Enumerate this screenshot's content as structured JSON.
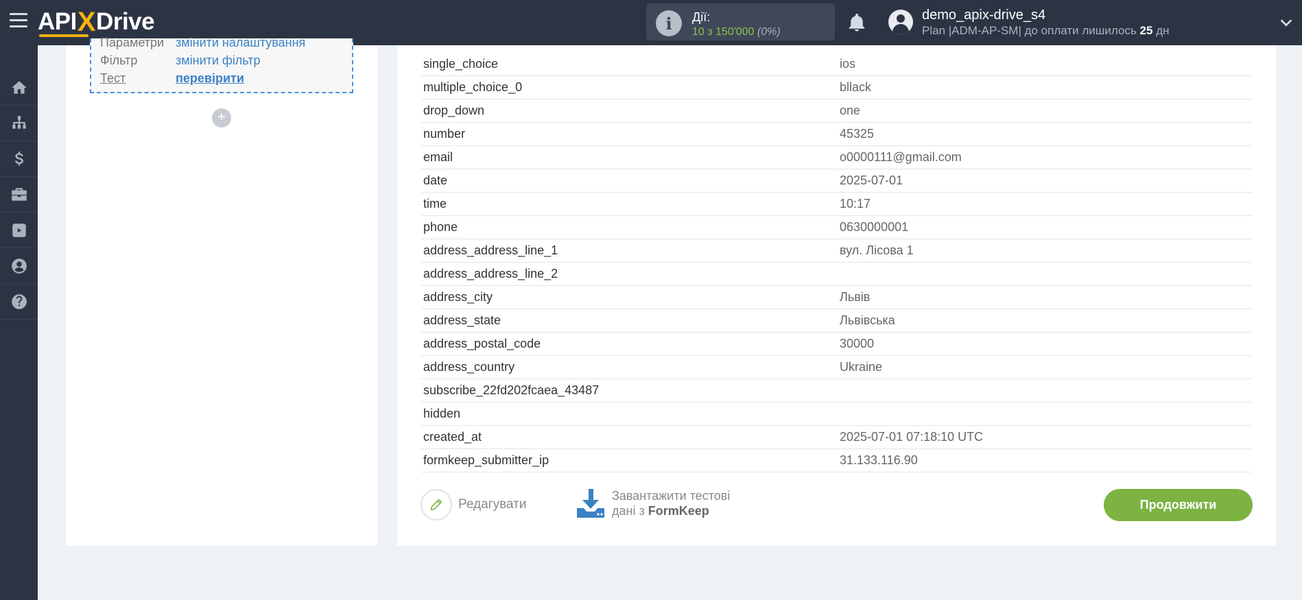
{
  "app": {
    "logo_pre": "API",
    "logo_x": "X",
    "logo_post": "Drive"
  },
  "topbar": {
    "actions_label": "Дії:",
    "actions_count": "10 з 150'000",
    "actions_percent": "(0%)",
    "user_name": "demo_apix-drive_s4",
    "plan_prefix": "Plan |ADM-AP-SM| до оплати лишилось ",
    "plan_days": "25",
    "plan_suffix": " дн"
  },
  "sidebar": {
    "items": [
      {
        "icon": "home-icon"
      },
      {
        "icon": "sitemap-icon"
      },
      {
        "icon": "dollar-icon"
      },
      {
        "icon": "briefcase-icon"
      },
      {
        "icon": "youtube-icon"
      },
      {
        "icon": "user-icon"
      },
      {
        "icon": "help-icon"
      }
    ]
  },
  "left_panel": {
    "cut_row": {
      "key": "Параметри",
      "value": "змінити налаштування"
    },
    "filter": {
      "key": "Фільтр",
      "value": "змінити фільтр"
    },
    "test": {
      "key": "Тест",
      "value": "перевірити"
    },
    "add_label": "+"
  },
  "data_table": {
    "rows": [
      {
        "field": "single_choice",
        "value": "ios"
      },
      {
        "field": "multiple_choice_0",
        "value": "bllack"
      },
      {
        "field": "drop_down",
        "value": "one"
      },
      {
        "field": "number",
        "value": "45325"
      },
      {
        "field": "email",
        "value": "o0000111@gmail.com"
      },
      {
        "field": "date",
        "value": "2025-07-01"
      },
      {
        "field": "time",
        "value": "10:17"
      },
      {
        "field": "phone",
        "value": "0630000001"
      },
      {
        "field": "address_address_line_1",
        "value": "вул. Лісова 1"
      },
      {
        "field": "address_address_line_2",
        "value": ""
      },
      {
        "field": "address_city",
        "value": "Львів"
      },
      {
        "field": "address_state",
        "value": "Львівська"
      },
      {
        "field": "address_postal_code",
        "value": "30000"
      },
      {
        "field": "address_country",
        "value": "Ukraine"
      },
      {
        "field": "subscribe_22fd202fcaea_43487",
        "value": ""
      },
      {
        "field": "hidden",
        "value": ""
      },
      {
        "field": "created_at",
        "value": "2025-07-01 07:18:10 UTC"
      },
      {
        "field": "formkeep_submitter_ip",
        "value": "31.133.116.90"
      }
    ]
  },
  "footer": {
    "edit_label": "Редагувати",
    "load_line1": "Завантажити тестові",
    "load_line2_prefix": "дані з ",
    "load_source": "FormKeep",
    "continue_label": "Продовжити"
  },
  "colors": {
    "accent_green": "#7cb342",
    "link_blue": "#3b82c4",
    "topbar": "#2c3444",
    "logo_x": "#f6b10f"
  }
}
